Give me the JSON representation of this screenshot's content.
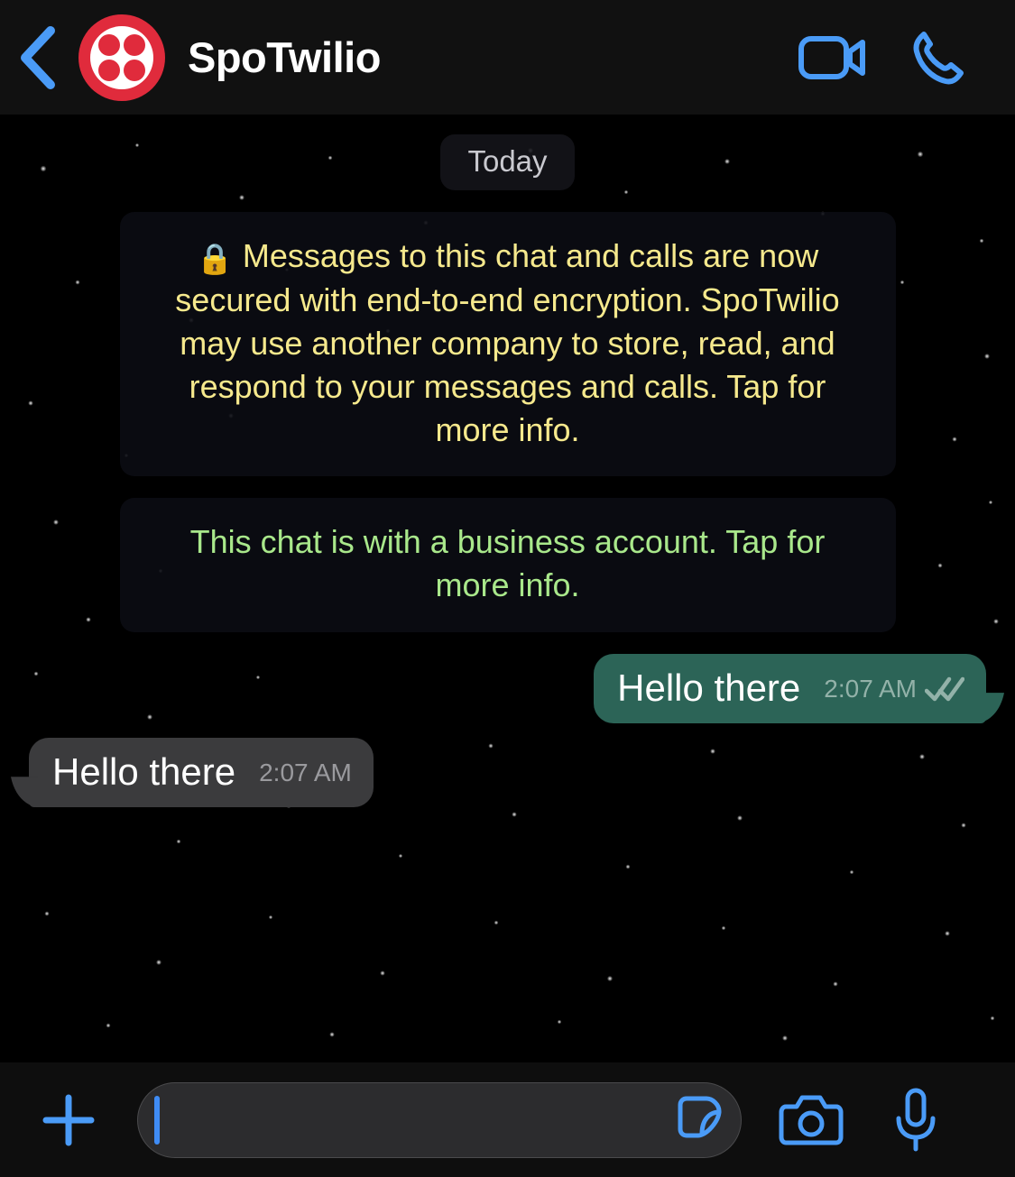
{
  "header": {
    "back_icon": "chevron-left-icon",
    "contact_name": "SpoTwilio",
    "avatar_name": "twilio-logo-avatar",
    "video_call_icon": "video-camera-icon",
    "voice_call_icon": "phone-icon",
    "accent_blue": "#4a9bf7",
    "background": "#111111"
  },
  "chat": {
    "date_divider": "Today",
    "notices": [
      {
        "id": "encryption-notice",
        "lock_icon": "🔒",
        "text": "Messages to this chat and calls are now secured with end-to-end encryption. SpoTwilio may use another company to store, read, and respond to your messages and calls. Tap for more info.",
        "color": "#f6e98d"
      },
      {
        "id": "business-account-notice",
        "text": "This chat is with a business account. Tap for more info.",
        "color": "#a9e88b"
      }
    ],
    "messages": [
      {
        "direction": "outgoing",
        "text": "Hello there",
        "time": "2:07 AM",
        "status": "delivered",
        "status_icon": "double-check-icon",
        "bubble_color": "#2c6457"
      },
      {
        "direction": "incoming",
        "text": "Hello there",
        "time": "2:07 AM",
        "status": "",
        "status_icon": "",
        "bubble_color": "#3b3b3d"
      }
    ]
  },
  "composer": {
    "attach_icon": "plus-icon",
    "input_value": "",
    "input_placeholder": "",
    "sticker_icon": "sticker-icon",
    "camera_icon": "camera-icon",
    "mic_icon": "microphone-icon",
    "caret_color": "#3f8cf5",
    "background": "#0e0e0e"
  }
}
